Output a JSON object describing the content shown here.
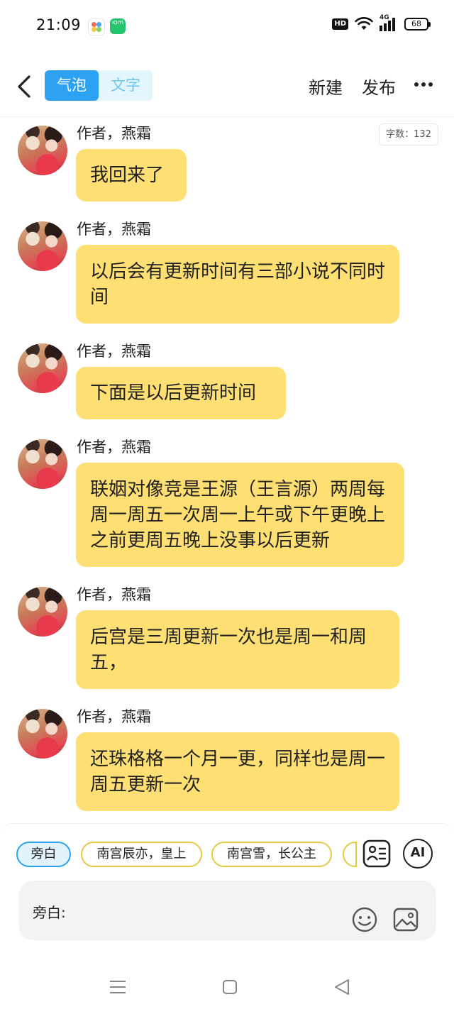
{
  "status_bar": {
    "time": "21:09",
    "app_badge_2": "iQIYI",
    "hd": "HD",
    "network": "4G",
    "battery": "68"
  },
  "nav": {
    "back_icon": "chevron-left-icon",
    "mode_bubble": "气泡",
    "mode_text": "文字",
    "new_label": "新建",
    "publish_label": "发布",
    "more_icon": "more-horizontal-icon",
    "active_color": "#2ea2f2"
  },
  "word_count": "字数：132",
  "messages": [
    {
      "sender": "作者，燕霜",
      "text": "我回来了"
    },
    {
      "sender": "作者，燕霜",
      "text": "以后会有更新时间有三部小说不同时间"
    },
    {
      "sender": "作者，燕霜",
      "text": "下面是以后更新时间"
    },
    {
      "sender": "作者，燕霜",
      "text": "联姻对像竞是王源（王言源）两周每周一周五一次周一上午或下午更晚上之前更周五晚上没事以后更新"
    },
    {
      "sender": "作者，燕霜",
      "text": "后宫是三周更新一次也是周一和周五，"
    },
    {
      "sender": "作者，燕霜",
      "text": "还珠格格一个月一更，同样也是周一周五更新一次"
    }
  ],
  "bubble_color": "#fedf73",
  "roles": {
    "selected": "旁白",
    "chip_1": "南宫辰亦，皇上",
    "chip_2": "南宫雪，长公主",
    "selected_color": "#2ea2f2",
    "chip_border_color": "#e8c845"
  },
  "tools": {
    "profile_icon": "character-card-icon",
    "ai_label": "AI"
  },
  "composer": {
    "label": "旁白:",
    "placeholder": "",
    "emoji_icon": "emoji-icon",
    "image_icon": "image-icon"
  },
  "system_nav": {
    "menu_icon": "menu-icon",
    "home_icon": "home-icon",
    "back_icon": "back-triangle-icon"
  }
}
